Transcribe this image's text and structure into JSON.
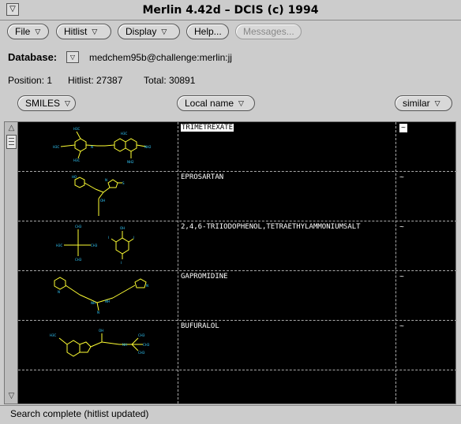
{
  "window": {
    "title": "Merlin 4.42d – DCIS (c) 1994",
    "menu_glyph": "▽"
  },
  "menubar": [
    {
      "label": "File",
      "has_menu": true
    },
    {
      "label": "Hitlist",
      "has_menu": true
    },
    {
      "label": "Display",
      "has_menu": true
    },
    {
      "label": "Help...",
      "has_menu": false
    },
    {
      "label": "Messages...",
      "has_menu": false,
      "disabled": true
    }
  ],
  "database": {
    "label": "Database:",
    "value": "medchem95b@challenge:merlin:jj"
  },
  "counts": {
    "position": "Position: 1",
    "hitlist": "Hitlist: 27387",
    "total": "Total: 30891"
  },
  "columns": {
    "structure": "SMILES",
    "name": "Local name",
    "similar": "similar"
  },
  "rows": [
    {
      "name": "TRIMETREXATE",
      "similar": "~",
      "selected": true
    },
    {
      "name": "EPROSARTAN",
      "similar": "~"
    },
    {
      "name": "2,4,6-TRIIODOPHENOL,TETRAETHYLAMMONIUMSALT",
      "similar": "~"
    },
    {
      "name": "GAPROMIDINE",
      "similar": "~"
    },
    {
      "name": "BUFURALOL",
      "similar": "~"
    },
    {
      "name": "",
      "similar": ""
    }
  ],
  "status": "Search complete (hitlist updated)",
  "colors": {
    "bond": "#ffff33",
    "atom": "#33ccff",
    "grid_bg": "#000000"
  }
}
